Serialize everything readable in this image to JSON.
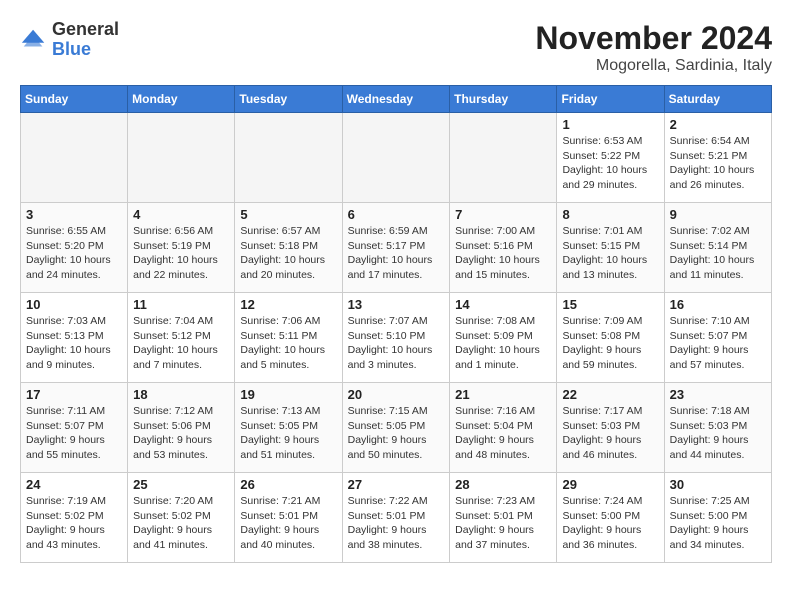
{
  "logo": {
    "general": "General",
    "blue": "Blue"
  },
  "title": "November 2024",
  "location": "Mogorella, Sardinia, Italy",
  "weekdays": [
    "Sunday",
    "Monday",
    "Tuesday",
    "Wednesday",
    "Thursday",
    "Friday",
    "Saturday"
  ],
  "weeks": [
    [
      {
        "day": "",
        "info": ""
      },
      {
        "day": "",
        "info": ""
      },
      {
        "day": "",
        "info": ""
      },
      {
        "day": "",
        "info": ""
      },
      {
        "day": "",
        "info": ""
      },
      {
        "day": "1",
        "info": "Sunrise: 6:53 AM\nSunset: 5:22 PM\nDaylight: 10 hours and 29 minutes."
      },
      {
        "day": "2",
        "info": "Sunrise: 6:54 AM\nSunset: 5:21 PM\nDaylight: 10 hours and 26 minutes."
      }
    ],
    [
      {
        "day": "3",
        "info": "Sunrise: 6:55 AM\nSunset: 5:20 PM\nDaylight: 10 hours and 24 minutes."
      },
      {
        "day": "4",
        "info": "Sunrise: 6:56 AM\nSunset: 5:19 PM\nDaylight: 10 hours and 22 minutes."
      },
      {
        "day": "5",
        "info": "Sunrise: 6:57 AM\nSunset: 5:18 PM\nDaylight: 10 hours and 20 minutes."
      },
      {
        "day": "6",
        "info": "Sunrise: 6:59 AM\nSunset: 5:17 PM\nDaylight: 10 hours and 17 minutes."
      },
      {
        "day": "7",
        "info": "Sunrise: 7:00 AM\nSunset: 5:16 PM\nDaylight: 10 hours and 15 minutes."
      },
      {
        "day": "8",
        "info": "Sunrise: 7:01 AM\nSunset: 5:15 PM\nDaylight: 10 hours and 13 minutes."
      },
      {
        "day": "9",
        "info": "Sunrise: 7:02 AM\nSunset: 5:14 PM\nDaylight: 10 hours and 11 minutes."
      }
    ],
    [
      {
        "day": "10",
        "info": "Sunrise: 7:03 AM\nSunset: 5:13 PM\nDaylight: 10 hours and 9 minutes."
      },
      {
        "day": "11",
        "info": "Sunrise: 7:04 AM\nSunset: 5:12 PM\nDaylight: 10 hours and 7 minutes."
      },
      {
        "day": "12",
        "info": "Sunrise: 7:06 AM\nSunset: 5:11 PM\nDaylight: 10 hours and 5 minutes."
      },
      {
        "day": "13",
        "info": "Sunrise: 7:07 AM\nSunset: 5:10 PM\nDaylight: 10 hours and 3 minutes."
      },
      {
        "day": "14",
        "info": "Sunrise: 7:08 AM\nSunset: 5:09 PM\nDaylight: 10 hours and 1 minute."
      },
      {
        "day": "15",
        "info": "Sunrise: 7:09 AM\nSunset: 5:08 PM\nDaylight: 9 hours and 59 minutes."
      },
      {
        "day": "16",
        "info": "Sunrise: 7:10 AM\nSunset: 5:07 PM\nDaylight: 9 hours and 57 minutes."
      }
    ],
    [
      {
        "day": "17",
        "info": "Sunrise: 7:11 AM\nSunset: 5:07 PM\nDaylight: 9 hours and 55 minutes."
      },
      {
        "day": "18",
        "info": "Sunrise: 7:12 AM\nSunset: 5:06 PM\nDaylight: 9 hours and 53 minutes."
      },
      {
        "day": "19",
        "info": "Sunrise: 7:13 AM\nSunset: 5:05 PM\nDaylight: 9 hours and 51 minutes."
      },
      {
        "day": "20",
        "info": "Sunrise: 7:15 AM\nSunset: 5:05 PM\nDaylight: 9 hours and 50 minutes."
      },
      {
        "day": "21",
        "info": "Sunrise: 7:16 AM\nSunset: 5:04 PM\nDaylight: 9 hours and 48 minutes."
      },
      {
        "day": "22",
        "info": "Sunrise: 7:17 AM\nSunset: 5:03 PM\nDaylight: 9 hours and 46 minutes."
      },
      {
        "day": "23",
        "info": "Sunrise: 7:18 AM\nSunset: 5:03 PM\nDaylight: 9 hours and 44 minutes."
      }
    ],
    [
      {
        "day": "24",
        "info": "Sunrise: 7:19 AM\nSunset: 5:02 PM\nDaylight: 9 hours and 43 minutes."
      },
      {
        "day": "25",
        "info": "Sunrise: 7:20 AM\nSunset: 5:02 PM\nDaylight: 9 hours and 41 minutes."
      },
      {
        "day": "26",
        "info": "Sunrise: 7:21 AM\nSunset: 5:01 PM\nDaylight: 9 hours and 40 minutes."
      },
      {
        "day": "27",
        "info": "Sunrise: 7:22 AM\nSunset: 5:01 PM\nDaylight: 9 hours and 38 minutes."
      },
      {
        "day": "28",
        "info": "Sunrise: 7:23 AM\nSunset: 5:01 PM\nDaylight: 9 hours and 37 minutes."
      },
      {
        "day": "29",
        "info": "Sunrise: 7:24 AM\nSunset: 5:00 PM\nDaylight: 9 hours and 36 minutes."
      },
      {
        "day": "30",
        "info": "Sunrise: 7:25 AM\nSunset: 5:00 PM\nDaylight: 9 hours and 34 minutes."
      }
    ]
  ]
}
